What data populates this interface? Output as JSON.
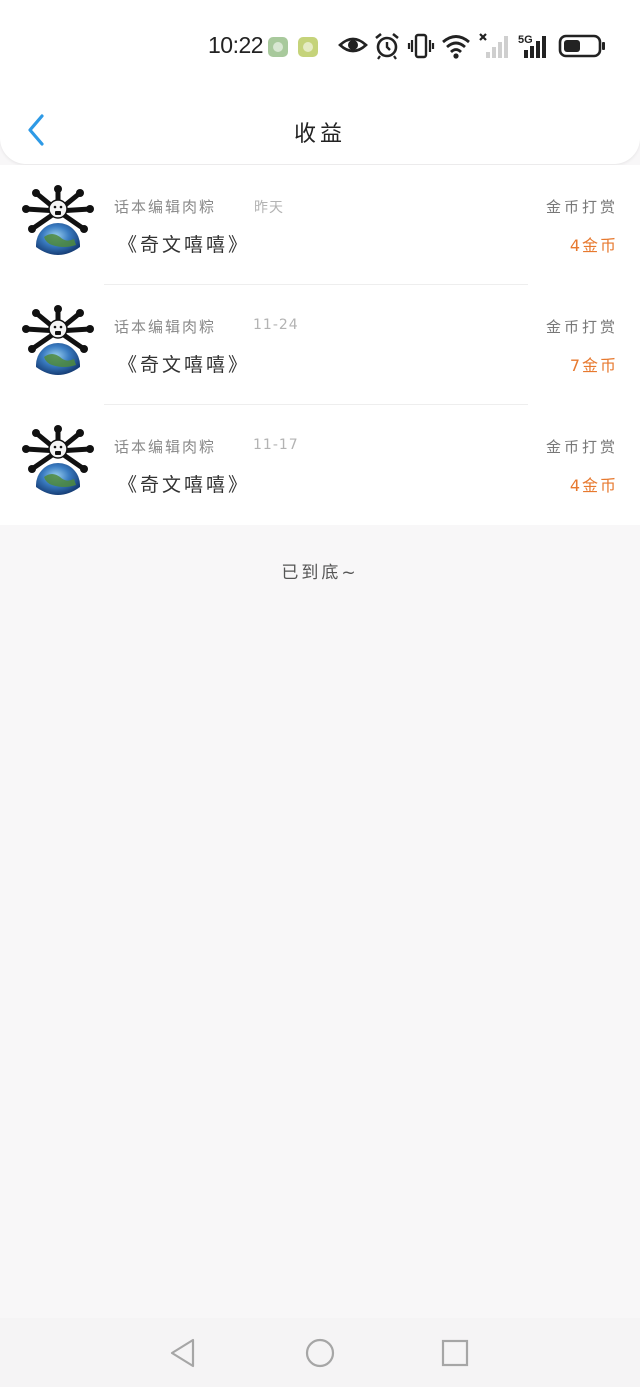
{
  "status_bar": {
    "time": "10:22",
    "network_label": "5G"
  },
  "header": {
    "title": "收益",
    "back_icon": "chevron-left-icon",
    "accent_color": "#2e9ae6"
  },
  "records": [
    {
      "user": "话本编辑肉粽",
      "time": "昨天",
      "title": "《奇文嘻嘻》",
      "type": "金币打赏",
      "amount": "4金币"
    },
    {
      "user": "话本编辑肉粽",
      "time": "11-24",
      "title": "《奇文嘻嘻》",
      "type": "金币打赏",
      "amount": "7金币"
    },
    {
      "user": "话本编辑肉粽",
      "time": "11-17",
      "title": "《奇文嘻嘻》",
      "type": "金币打赏",
      "amount": "4金币"
    }
  ],
  "footer": {
    "end_text": "已到底~"
  },
  "colors": {
    "amount": "#e7792f",
    "background": "#f8f7f8"
  }
}
